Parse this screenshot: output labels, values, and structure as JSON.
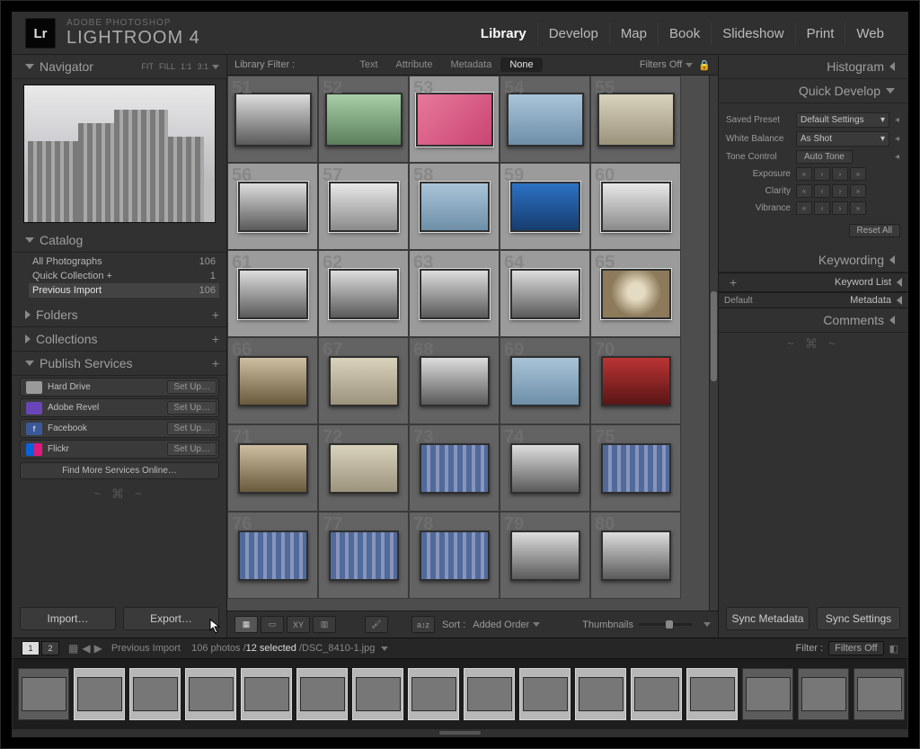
{
  "brand": {
    "app_prefix": "ADOBE PHOTOSHOP",
    "app_name": "LIGHTROOM 4",
    "logo": "Lr"
  },
  "modules": {
    "items": [
      "Library",
      "Develop",
      "Map",
      "Book",
      "Slideshow",
      "Print",
      "Web"
    ],
    "active": "Library"
  },
  "left": {
    "navigator": {
      "title": "Navigator",
      "modes": [
        "FIT",
        "FILL",
        "1:1",
        "3:1"
      ]
    },
    "catalog": {
      "title": "Catalog",
      "items": [
        {
          "label": "All Photographs",
          "count": "106"
        },
        {
          "label": "Quick Collection  +",
          "count": "1"
        },
        {
          "label": "Previous Import",
          "count": "106"
        }
      ],
      "active_index": 2
    },
    "folders": {
      "title": "Folders"
    },
    "collections": {
      "title": "Collections"
    },
    "publish": {
      "title": "Publish Services",
      "items": [
        {
          "label": "Hard Drive",
          "cls": "hd"
        },
        {
          "label": "Adobe Revel",
          "cls": "revel"
        },
        {
          "label": "Facebook",
          "cls": "fb"
        },
        {
          "label": "Flickr",
          "cls": "flickr"
        }
      ],
      "setup": "Set Up…",
      "find_more": "Find More Services Online…"
    },
    "import_btn": "Import…",
    "export_btn": "Export…"
  },
  "center": {
    "filter": {
      "label": "Library Filter :",
      "tabs": [
        "Text",
        "Attribute",
        "Metadata",
        "None"
      ],
      "active": "None",
      "filters_off": "Filters Off"
    },
    "grid": {
      "start": 51,
      "rows": 6,
      "cols": 5,
      "selected": [
        53,
        56,
        57,
        58,
        59,
        60,
        61,
        62,
        63,
        64,
        65
      ]
    },
    "toolbar": {
      "sort_label": "Sort :",
      "sort_value": "Added Order",
      "thumbnails": "Thumbnails"
    }
  },
  "right": {
    "histogram": "Histogram",
    "quick": {
      "title": "Quick Develop",
      "rows": {
        "saved_preset": {
          "label": "Saved Preset",
          "value": "Default Settings"
        },
        "white_balance": {
          "label": "White Balance",
          "value": "As Shot"
        },
        "tone_control": {
          "label": "Tone Control",
          "button": "Auto Tone"
        }
      },
      "sliders": [
        "Exposure",
        "Clarity",
        "Vibrance"
      ],
      "reset": "Reset All"
    },
    "panels": [
      "Keywording",
      "Keyword List",
      "Metadata",
      "Comments"
    ],
    "metadata_preset": "Default",
    "sync_metadata": "Sync Metadata",
    "sync_settings": "Sync Settings"
  },
  "info": {
    "source": "Previous Import",
    "count": "106 photos",
    "selected": "12 selected",
    "file": "DSC_8410-1.jpg",
    "filter_label": "Filter :",
    "filter_value": "Filters Off",
    "windows": [
      "1",
      "2"
    ]
  }
}
